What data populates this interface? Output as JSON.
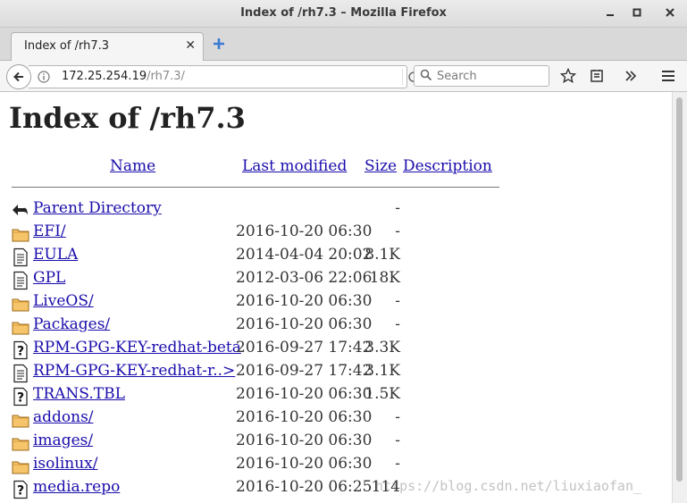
{
  "window": {
    "title": "Index of /rh7.3 – Mozilla Firefox"
  },
  "tabs": [
    {
      "label": "Index of /rh7.3"
    }
  ],
  "navbar": {
    "url_host": "172.25.254.19",
    "url_path": "/rh7.3/",
    "search_placeholder": "Search"
  },
  "page": {
    "heading": "Index of /rh7.3",
    "columns": {
      "name": "Name",
      "last_modified": "Last modified",
      "size": "Size",
      "description": "Description"
    },
    "rows": [
      {
        "icon": "back-icon",
        "name": "Parent Directory",
        "modified": "",
        "size": "-"
      },
      {
        "icon": "folder-icon",
        "name": "EFI/",
        "modified": "2016-10-20 06:30",
        "size": "-"
      },
      {
        "icon": "text-icon",
        "name": "EULA",
        "modified": "2014-04-04 20:02",
        "size": "8.1K"
      },
      {
        "icon": "text-icon",
        "name": "GPL",
        "modified": "2012-03-06 22:06",
        "size": "18K"
      },
      {
        "icon": "folder-icon",
        "name": "LiveOS/",
        "modified": "2016-10-20 06:30",
        "size": "-"
      },
      {
        "icon": "folder-icon",
        "name": "Packages/",
        "modified": "2016-10-20 06:30",
        "size": "-"
      },
      {
        "icon": "unknown-icon",
        "name": "RPM-GPG-KEY-redhat-beta",
        "modified": "2016-09-27 17:42",
        "size": "3.3K"
      },
      {
        "icon": "text-icon",
        "name": "RPM-GPG-KEY-redhat-r..>",
        "modified": "2016-09-27 17:42",
        "size": "3.1K"
      },
      {
        "icon": "unknown-icon",
        "name": "TRANS.TBL",
        "modified": "2016-10-20 06:30",
        "size": "1.5K"
      },
      {
        "icon": "folder-icon",
        "name": "addons/",
        "modified": "2016-10-20 06:30",
        "size": "-"
      },
      {
        "icon": "folder-icon",
        "name": "images/",
        "modified": "2016-10-20 06:30",
        "size": "-"
      },
      {
        "icon": "folder-icon",
        "name": "isolinux/",
        "modified": "2016-10-20 06:30",
        "size": "-"
      },
      {
        "icon": "unknown-icon",
        "name": "media.repo",
        "modified": "2016-10-20 06:25",
        "size": "114"
      }
    ]
  },
  "watermark": "https://blog.csdn.net/liuxiaofan_"
}
